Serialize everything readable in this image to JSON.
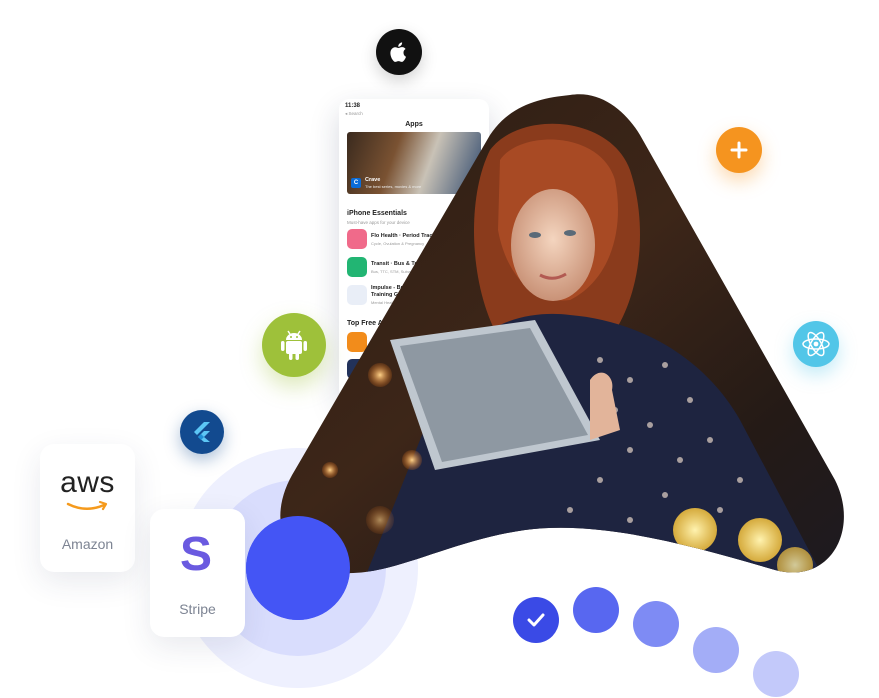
{
  "platform_icons": {
    "apple": "apple-icon",
    "plus": "plus-icon",
    "android": "android-icon",
    "react": "react-icon",
    "flutter": "flutter-icon"
  },
  "cards": {
    "aws": {
      "logo_text": "aws",
      "label": "Amazon"
    },
    "stripe": {
      "logo_text": "S",
      "label": "Stripe"
    }
  },
  "phone": {
    "time": "11:38",
    "back_label": "◂ Search",
    "title": "Apps",
    "banner": {
      "name": "Crave",
      "subtitle": "The best series, movies & more"
    },
    "section1": {
      "title": "iPhone Essentials",
      "subtitle": "Must-have apps for your device"
    },
    "apps": [
      {
        "name": "Flo Health · Period Tracke",
        "desc": "Cycle, Ovulation & Pregnancy"
      },
      {
        "name": "Transit · Bus & Train",
        "desc": "Bus, TTC, STM, Subway"
      },
      {
        "name": "Impulse - Brair",
        "name2": "Training Gam",
        "desc": "Mental Health"
      }
    ],
    "section2": {
      "title": "Top Free Ap"
    }
  },
  "colors": {
    "apple_bg": "#111111",
    "plus_bg": "#f5941f",
    "android_bg": "#9ec13a",
    "react_bg": "#52c6e8",
    "flutter_bg": "#124a8f",
    "accent_blue": "#4455f5",
    "stripe_purple": "#6a5ae0"
  }
}
